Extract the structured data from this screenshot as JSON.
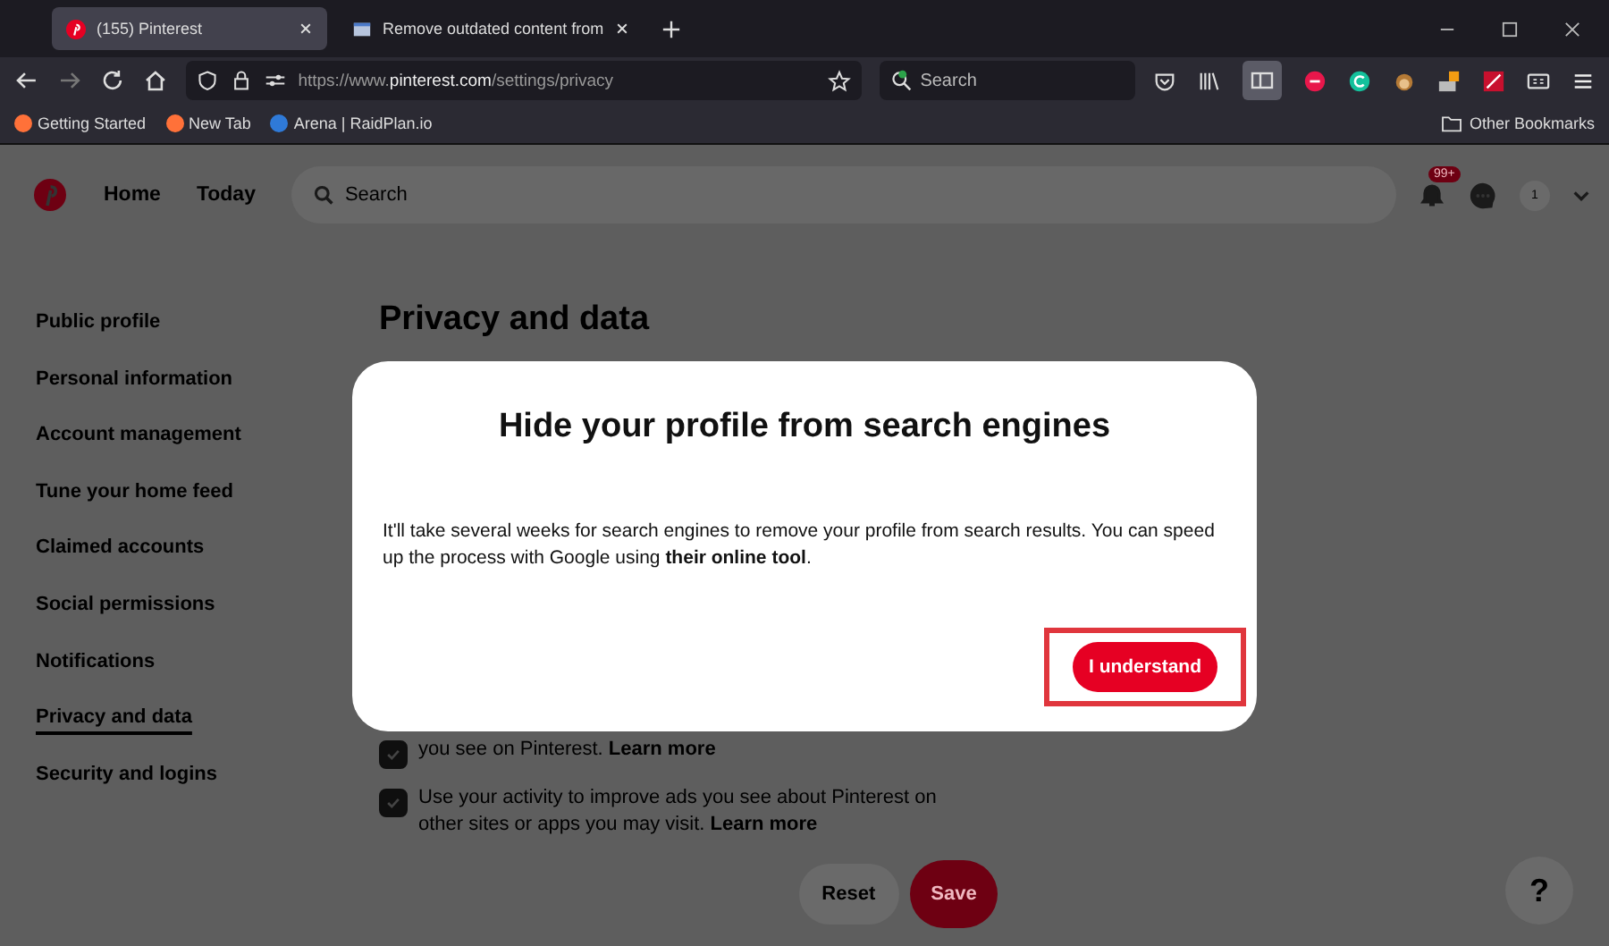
{
  "browser": {
    "tabs": [
      {
        "title": "(155) Pinterest",
        "selected": true,
        "kind": "pinterest"
      },
      {
        "title": "Remove outdated content from",
        "selected": false,
        "kind": "page"
      }
    ],
    "url_prefix": "https://www.",
    "url_host": "pinterest.com",
    "url_path": "/settings/privacy",
    "search_placeholder": "Search",
    "bookmarks": [
      {
        "label": "Getting Started",
        "kind": "firefox"
      },
      {
        "label": "New Tab",
        "kind": "firefox"
      },
      {
        "label": "Arena | RaidPlan.io",
        "kind": "arena"
      }
    ],
    "other_bookmarks": "Other Bookmarks"
  },
  "header": {
    "nav": [
      "Home",
      "Today"
    ],
    "search_placeholder": "Search",
    "badge": "99+",
    "avatar": "1"
  },
  "sidebar": {
    "items": [
      {
        "label": "Public profile",
        "selected": false
      },
      {
        "label": "Personal information",
        "selected": false
      },
      {
        "label": "Account management",
        "selected": false
      },
      {
        "label": "Tune your home feed",
        "selected": false
      },
      {
        "label": "Claimed accounts",
        "selected": false
      },
      {
        "label": "Social permissions",
        "selected": false
      },
      {
        "label": "Notifications",
        "selected": false
      },
      {
        "label": "Privacy and data",
        "selected": true
      },
      {
        "label": "Security and logins",
        "selected": false
      }
    ]
  },
  "page": {
    "title": "Privacy and data",
    "options": [
      {
        "text": "you see on Pinterest. **Learn more**",
        "checked": true
      },
      {
        "text": "Use your activity to improve ads you see about Pinterest on other sites or apps you may visit. **Learn more**",
        "checked": true
      }
    ]
  },
  "footer": {
    "buttons": [
      {
        "label": "Reset",
        "kind": "secondary"
      },
      {
        "label": "Save",
        "kind": "primary"
      }
    ],
    "help": "?"
  },
  "dialog": {
    "title": "Hide your profile from search engines",
    "body": "It'll take several weeks for search engines to remove your profile from search results. You can speed up the process with Google using **their online tool**.",
    "button": "I understand",
    "highlighted": true
  }
}
